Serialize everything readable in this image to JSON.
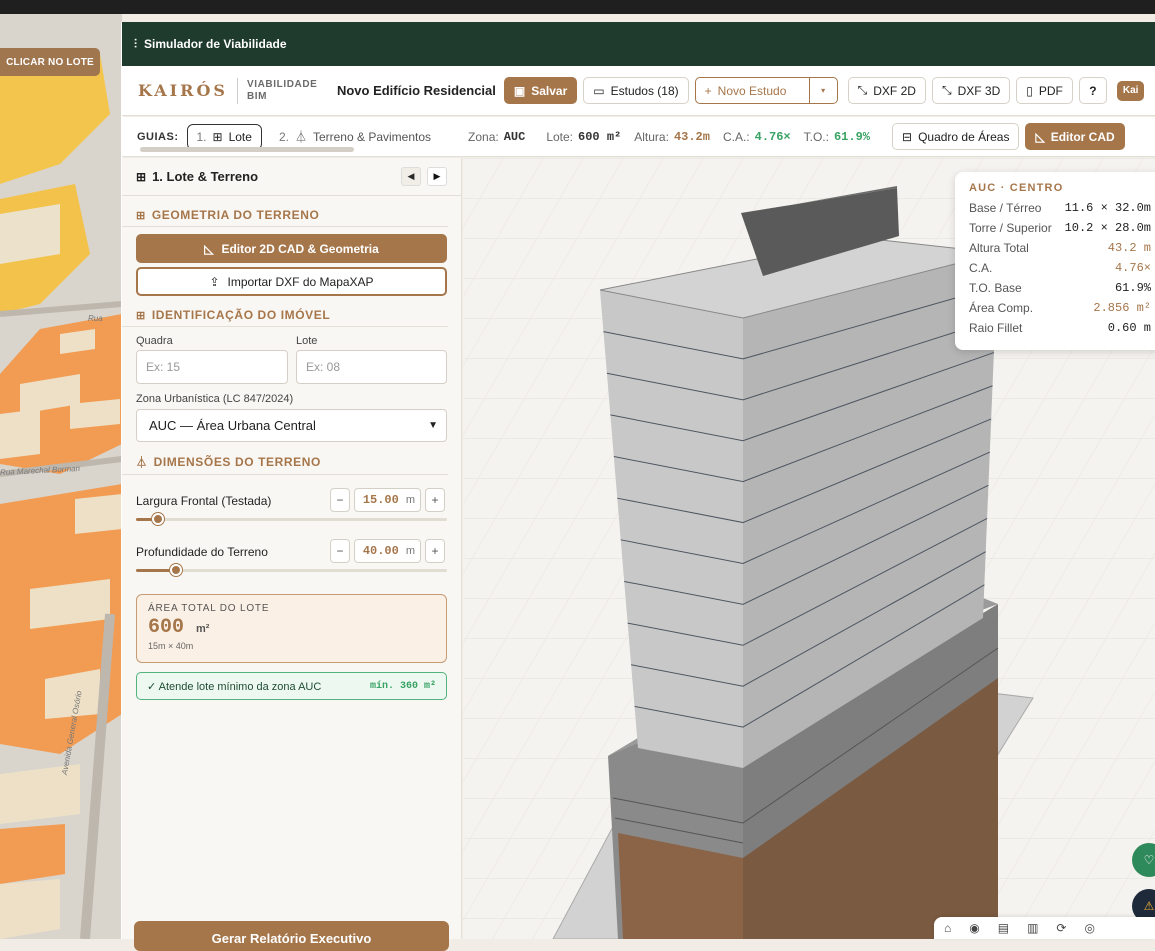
{
  "map": {
    "button_label": "CLICAR NO LOTE",
    "streets": [
      "Rua",
      "Rua Marechal Borman",
      "Avenida General Osório"
    ]
  },
  "topbar": {
    "title": "Simulador de Viabilidade",
    "icon": "sliders-icon"
  },
  "header": {
    "logo": "KAIRÓS",
    "logo_sub": "VIABILIDADE BIM",
    "project_name": "Novo Edifício Residencial",
    "save_label": "Salvar",
    "studies_label": "Estudos (18)",
    "new_study_label": "Novo Estudo",
    "dxf2d_label": "DXF 2D",
    "dxf3d_label": "DXF 3D",
    "pdf_label": "PDF",
    "help_label": "?",
    "user_label": "Kai"
  },
  "guides": {
    "label": "GUIAS:",
    "tabs": [
      {
        "num": "1.",
        "label": "Lote"
      },
      {
        "num": "2.",
        "label": "Terreno & Pavimentos"
      }
    ],
    "zone_label": "Zona:",
    "zone_value": "AUC",
    "lot_label": "Lote:",
    "lot_value": "600 m²",
    "height_label": "Altura:",
    "height_value": "43.2m",
    "ca_label": "C.A.:",
    "ca_value": "4.76×",
    "to_label": "T.O.:",
    "to_value": "61.9%",
    "areas_label": "Quadro de Áreas",
    "editor_label": "Editor CAD"
  },
  "panel": {
    "title": "1. Lote & Terreno",
    "geometry_section": "GEOMETRIA DO TERRENO",
    "cad_button": "Editor 2D CAD & Geometria",
    "import_button": "Importar DXF do MapaXAP",
    "id_section": "IDENTIFICAÇÃO DO IMÓVEL",
    "quadra_label": "Quadra",
    "quadra_placeholder": "Ex: 15",
    "lote_label": "Lote",
    "lote_placeholder": "Ex: 08",
    "zone_label": "Zona Urbanística (LC 847/2024)",
    "zone_selected": "AUC — Área Urbana Central",
    "dim_section": "DIMENSÕES DO TERRENO",
    "width_label": "Largura Frontal (Testada)",
    "width_value": "15.00",
    "width_unit": "m",
    "width_fraction": 0.07,
    "depth_label": "Profundidade do Terreno",
    "depth_value": "40.00",
    "depth_unit": "m",
    "depth_fraction": 0.13,
    "area_title": "ÁREA TOTAL DO LOTE",
    "area_value": "600",
    "area_unit": "m²",
    "area_sub": "15m × 40m",
    "check_text": "✓ Atende lote mínimo da zona AUC",
    "check_min": "mín. 360 m²",
    "report_button": "Gerar Relatório Executivo"
  },
  "info": {
    "title": "AUC · CENTRO",
    "rows": [
      {
        "k": "Base / Térreo",
        "v": "11.6 × 32.0m"
      },
      {
        "k": "Torre / Superior",
        "v": "10.2 × 28.0m"
      },
      {
        "k": "Altura Total",
        "v": "43.2 m"
      },
      {
        "k": "C.A.",
        "v": "4.76×"
      },
      {
        "k": "T.O. Base",
        "v": "61.9%"
      },
      {
        "k": "Área Comp.",
        "v": "2.856 m²"
      },
      {
        "k": "Raio Fillet",
        "v": "0.60 m"
      }
    ]
  },
  "colors": {
    "brand": "#a6764b",
    "dark_green": "#1e3b2d",
    "ok_green": "#38a364"
  }
}
